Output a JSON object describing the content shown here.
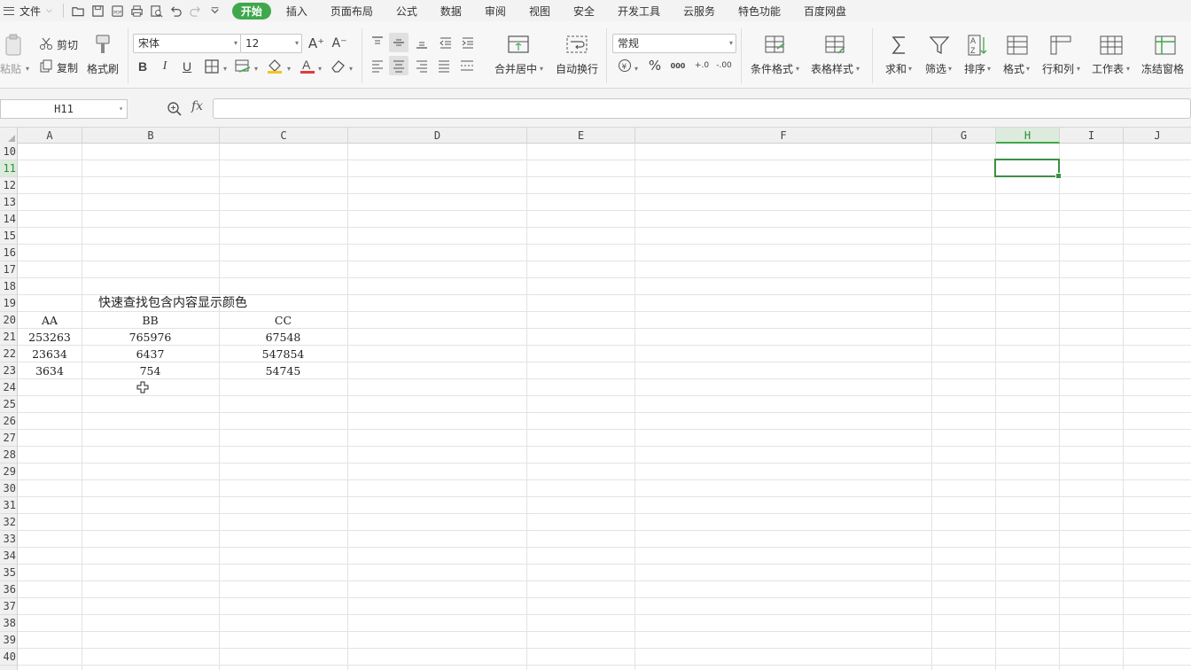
{
  "menubar": {
    "file_label": "文件",
    "tabs": [
      "开始",
      "插入",
      "页面布局",
      "公式",
      "数据",
      "审阅",
      "视图",
      "安全",
      "开发工具",
      "云服务",
      "特色功能",
      "百度网盘"
    ],
    "active_tab": "开始"
  },
  "ribbon": {
    "paste": "粘贴",
    "cut": "剪切",
    "copy": "复制",
    "format_painter": "格式刷",
    "font_name": "宋体",
    "font_size": "12",
    "merge_center": "合并居中",
    "wrap_text": "自动换行",
    "number_format": "常规",
    "conditional_format": "条件格式",
    "table_style": "表格样式",
    "sum": "求和",
    "filter": "筛选",
    "sort": "排序",
    "format": "格式",
    "rows_cols": "行和列",
    "worksheet": "工作表",
    "freeze": "冻结窗格",
    "font_grow": "A⁺",
    "font_shrink": "A⁻",
    "percent": "%",
    "thousands": "000",
    "inc_decimal": "+.0",
    "dec_decimal": "-.00"
  },
  "formula_bar": {
    "name_box": "H11",
    "fx_label": "fx",
    "formula": ""
  },
  "sheet": {
    "columns": [
      "A",
      "B",
      "C",
      "D",
      "E",
      "F",
      "G",
      "H",
      "I",
      "J"
    ],
    "selected_column": "H",
    "rows": [
      "10",
      "11",
      "12",
      "13",
      "14",
      "15",
      "16",
      "17",
      "18",
      "19",
      "20",
      "21",
      "22",
      "23",
      "24",
      "25",
      "26",
      "27",
      "28",
      "29",
      "30",
      "31",
      "32",
      "33",
      "34",
      "35",
      "36",
      "37",
      "38",
      "39",
      "40"
    ],
    "selected_row": "11",
    "title": "快速查找包含内容显示颜色",
    "headers": [
      "AA",
      "BB",
      "CC"
    ],
    "data": [
      [
        "253263",
        "765976",
        "67548"
      ],
      [
        "23634",
        "6437",
        "547854"
      ],
      [
        "3634",
        "754",
        "54745"
      ]
    ]
  }
}
